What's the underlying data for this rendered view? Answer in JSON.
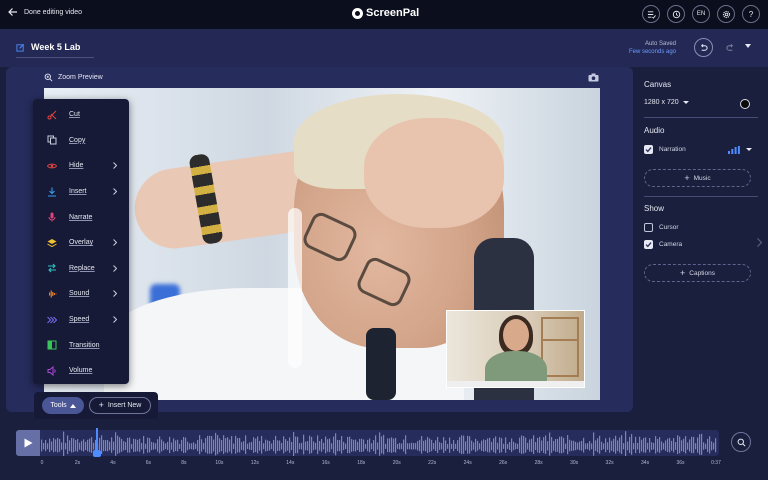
{
  "header": {
    "back_label": "Done editing video",
    "logo_text": "ScreenPal",
    "language": "EN",
    "help": "?"
  },
  "project": {
    "title": "Week 5 Lab",
    "autosave_label": "Auto Saved",
    "autosave_time": "Few seconds ago"
  },
  "preview": {
    "zoom_label": "Zoom Preview"
  },
  "context_menu": {
    "items": [
      {
        "label": "Cut",
        "icon": "scissors-icon",
        "color": "#e0443f",
        "submenu": false
      },
      {
        "label": "Copy",
        "icon": "copy-icon",
        "color": "#c9ccdc",
        "submenu": false
      },
      {
        "label": "Hide",
        "icon": "eye-icon",
        "color": "#e0443f",
        "submenu": true
      },
      {
        "label": "Insert",
        "icon": "insert-icon",
        "color": "#3c9bf0",
        "submenu": true
      },
      {
        "label": "Narrate",
        "icon": "microphone-icon",
        "color": "#e0447a",
        "submenu": false
      },
      {
        "label": "Overlay",
        "icon": "layers-icon",
        "color": "#f2c230",
        "submenu": true
      },
      {
        "label": "Replace",
        "icon": "replace-icon",
        "color": "#2ec4c4",
        "submenu": true
      },
      {
        "label": "Sound",
        "icon": "waveform-icon",
        "color": "#f08a2e",
        "submenu": true
      },
      {
        "label": "Speed",
        "icon": "fast-forward-icon",
        "color": "#7b6cf0",
        "submenu": true
      },
      {
        "label": "Transition",
        "icon": "transition-icon",
        "color": "#39c45a",
        "submenu": false
      },
      {
        "label": "Volume",
        "icon": "speaker-icon",
        "color": "#b04ad8",
        "submenu": false
      }
    ]
  },
  "tools": {
    "tools_label": "Tools",
    "insert_label": "Insert New"
  },
  "right_panel": {
    "canvas_heading": "Canvas",
    "canvas_size": "1280 x 720",
    "audio_heading": "Audio",
    "narration_label": "Narration",
    "narration_checked": true,
    "music_label": "Music",
    "show_heading": "Show",
    "cursor_label": "Cursor",
    "cursor_checked": false,
    "camera_label": "Camera",
    "camera_checked": true,
    "captions_label": "Captions"
  },
  "timeline": {
    "tick_labels": [
      "0",
      "2s",
      "4s",
      "6s",
      "8s",
      "10s",
      "12s",
      "14s",
      "16s",
      "18s",
      "20s",
      "22s",
      "24s",
      "26s",
      "28s",
      "30s",
      "32s",
      "34s",
      "36s",
      "0:37"
    ],
    "playhead_seconds": 3,
    "duration_seconds": 37
  }
}
